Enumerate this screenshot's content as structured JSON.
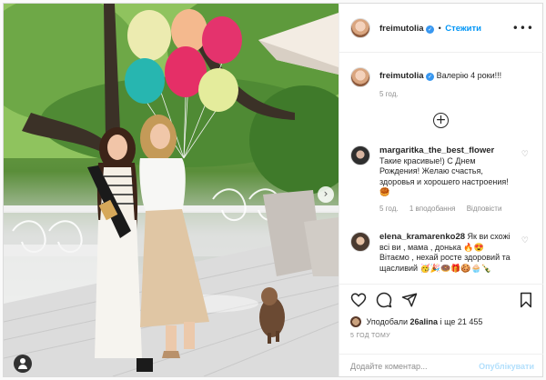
{
  "post": {
    "photo_alt": "",
    "author": {
      "username": "freimutolia",
      "follow_label": "Стежити",
      "separator": "•"
    },
    "caption": {
      "username": "freimutolia",
      "text": "⁣⁣⁣Валерію 4 роки!!!",
      "time": "5 год."
    }
  },
  "comments": [
    {
      "username": "margaritka_the_best_flower",
      "text": "Такие красивые!) С Днем Рождения! Желаю счастья, здоровья и хорошего настроения!🥮",
      "time": "5 год.",
      "likes": "1 вподобання",
      "reply": "Відповісти"
    },
    {
      "username": "elena_kramarenko28",
      "text": "Як ви схожі всі ви , мама , донька 🔥😍 Вітаємо , нехай росте здоровий та щасливий 🥳🎉🍩🎁🍪🧁🍾",
      "time": "",
      "likes": "",
      "reply": ""
    }
  ],
  "likes": {
    "prefix": "Уподобали",
    "user": "26alina",
    "suffix": "і ще 21 455"
  },
  "time_ago": "5 ГОД ТОМУ",
  "comment_box": {
    "placeholder": "Додайте коментар...",
    "publish_label": "Опублікувати"
  },
  "colors": {
    "accent": "#0095f6",
    "text": "#262626",
    "muted": "#8e8e8e",
    "border": "#dbdbdb"
  }
}
